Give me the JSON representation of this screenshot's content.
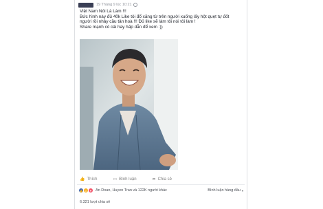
{
  "post": {
    "timestamp": "19 Tháng 9 lúc 10:21",
    "lines": [
      "Việt Nam Nói Là Làm !!!",
      "Bức hình này đủ 40k Like tôi đổ xăng từ trên người xuống lấy hột quẹt tự đốt",
      "người rồi nhảy cầu tân hoà !!! Đủ like sẽ làm tôi nói tôi làm !",
      "Share mạnh có cái hay hấp dẫn để xem :))"
    ]
  },
  "actions": {
    "like": "Thích",
    "comment": "Bình luận",
    "share": "Chia sẻ"
  },
  "summary": {
    "reactions": "An Doan, Huyen Tran và 122K người khác",
    "sort": "Bình luận hàng đầu",
    "shares": "6.321 lượt chia sẻ"
  }
}
